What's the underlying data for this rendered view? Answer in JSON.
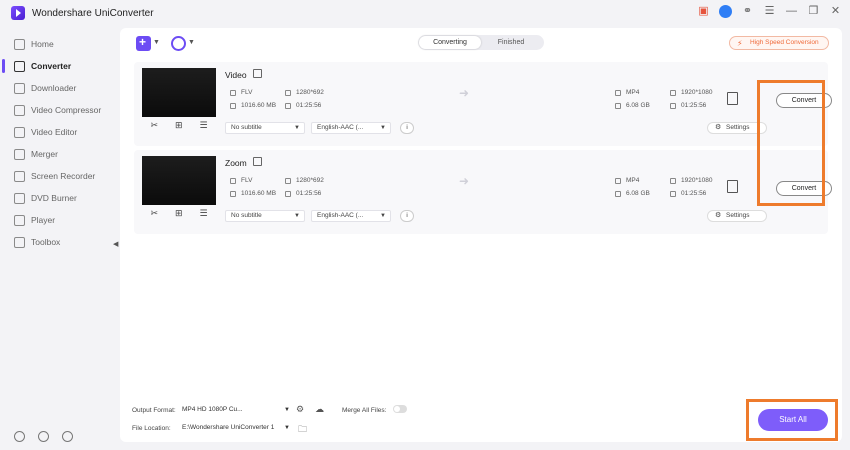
{
  "app": {
    "title": "Wondershare UniConverter"
  },
  "sidebar": {
    "items": [
      {
        "label": "Home",
        "icon": "home-icon"
      },
      {
        "label": "Converter",
        "icon": "converter-icon"
      },
      {
        "label": "Downloader",
        "icon": "download-icon"
      },
      {
        "label": "Video Compressor",
        "icon": "compress-icon"
      },
      {
        "label": "Video Editor",
        "icon": "scissors-icon"
      },
      {
        "label": "Merger",
        "icon": "merge-icon"
      },
      {
        "label": "Screen Recorder",
        "icon": "record-icon"
      },
      {
        "label": "DVD Burner",
        "icon": "disc-icon"
      },
      {
        "label": "Player",
        "icon": "play-icon"
      },
      {
        "label": "Toolbox",
        "icon": "grid-icon"
      }
    ],
    "active": "Converter"
  },
  "tabs": {
    "converting": "Converting",
    "finished": "Finished"
  },
  "high_speed": "High Speed Conversion",
  "files": [
    {
      "name": "Video",
      "src": {
        "format": "FLV",
        "resolution": "1280*692",
        "size": "1016.60 MB",
        "duration": "01:25:56"
      },
      "out": {
        "format": "MP4",
        "resolution": "1920*1080",
        "size": "6.08 GB",
        "duration": "01:25:56"
      },
      "subtitle": "No subtitle",
      "audio": "English-AAC (...",
      "settings": "Settings",
      "convert": "Convert"
    },
    {
      "name": "Zoom",
      "src": {
        "format": "FLV",
        "resolution": "1280*692",
        "size": "1016.60 MB",
        "duration": "01:25:56"
      },
      "out": {
        "format": "MP4",
        "resolution": "1920*1080",
        "size": "6.08 GB",
        "duration": "01:25:56"
      },
      "subtitle": "No subtitle",
      "audio": "English-AAC (...",
      "settings": "Settings",
      "convert": "Convert"
    }
  ],
  "footer": {
    "output_format_label": "Output Format:",
    "output_format_value": "MP4 HD 1080P Cu...",
    "merge_label": "Merge All Files:",
    "file_location_label": "File Location:",
    "file_location_value": "E:\\Wondershare UniConverter 1",
    "start_all": "Start All"
  },
  "colors": {
    "accent": "#6c4cf4",
    "highlight": "#ee7b2c",
    "start_btn": "#7e5dfa"
  }
}
